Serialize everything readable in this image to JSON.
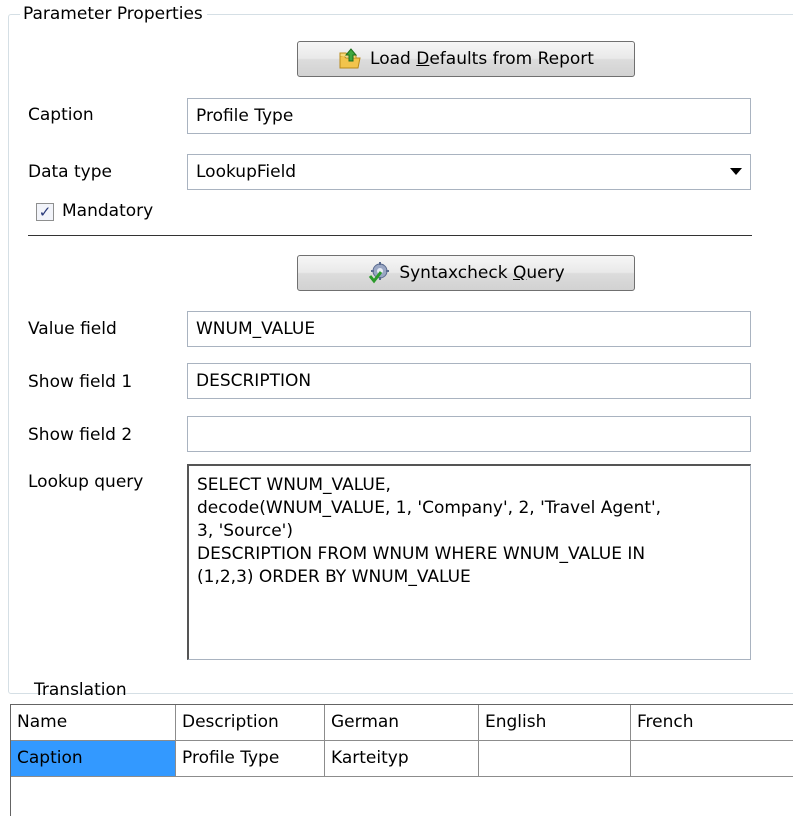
{
  "group": {
    "title": "Parameter Properties"
  },
  "buttons": {
    "load_defaults": {
      "prefix": "Load ",
      "mnemonic": "D",
      "suffix": "efaults from Report"
    },
    "syntax_check": {
      "prefix": "Syntaxcheck ",
      "mnemonic": "Q",
      "suffix": "uery"
    }
  },
  "fields": {
    "caption": {
      "label": "Caption",
      "value": "Profile Type"
    },
    "data_type": {
      "label": "Data type",
      "value": "LookupField"
    },
    "mandatory": {
      "label": "Mandatory",
      "checked": true,
      "mark": "✓"
    },
    "value_field": {
      "label": "Value field",
      "value": "WNUM_VALUE"
    },
    "show_field_1": {
      "label": "Show field 1",
      "value": "DESCRIPTION"
    },
    "show_field_2": {
      "label": "Show field 2",
      "value": ""
    },
    "lookup_query": {
      "label": "Lookup query",
      "lines": [
        "SELECT WNUM_VALUE,",
        "decode(WNUM_VALUE, 1, 'Company', 2, 'Travel Agent',",
        "3, 'Source')",
        "DESCRIPTION FROM WNUM WHERE WNUM_VALUE IN",
        "(1,2,3) ORDER BY WNUM_VALUE"
      ]
    }
  },
  "translation": {
    "label": "Translation",
    "columns": [
      "Name",
      "Description",
      "German",
      "English",
      "French"
    ],
    "rows": [
      [
        "Caption",
        "Profile Type",
        "Karteityp",
        "",
        ""
      ]
    ]
  },
  "colors": {
    "selection": "#3399ff",
    "border": "#a9b3c0"
  },
  "icons": {
    "load_defaults": "folder-up-icon",
    "syntax_check": "gear-check-icon",
    "dropdown": "chevron-down-icon"
  }
}
